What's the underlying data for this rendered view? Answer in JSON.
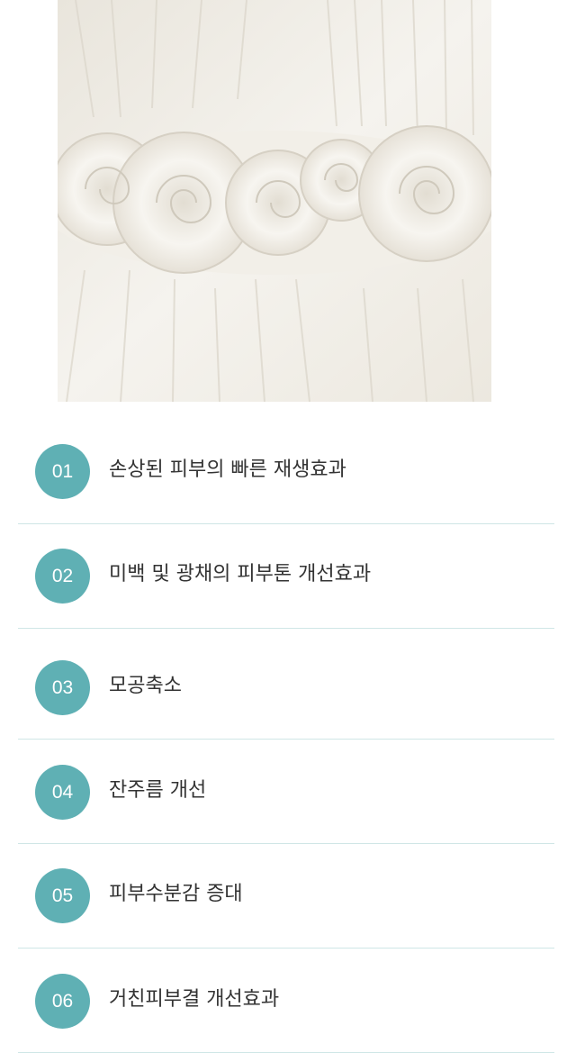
{
  "hero_image": {
    "subject": "white chiffon fabric with rosette flowers"
  },
  "colors": {
    "badge": "#5fb0b4",
    "divider": "#cfe6e6",
    "text": "#333333"
  },
  "items": [
    {
      "number": "01",
      "label": "손상된 피부의 빠른 재생효과"
    },
    {
      "number": "02",
      "label": "미백 및 광채의 피부톤 개선효과"
    },
    {
      "number": "03",
      "label": "모공축소"
    },
    {
      "number": "04",
      "label": "잔주름 개선"
    },
    {
      "number": "05",
      "label": "피부수분감 증대"
    },
    {
      "number": "06",
      "label": "거친피부결 개선효과"
    }
  ]
}
